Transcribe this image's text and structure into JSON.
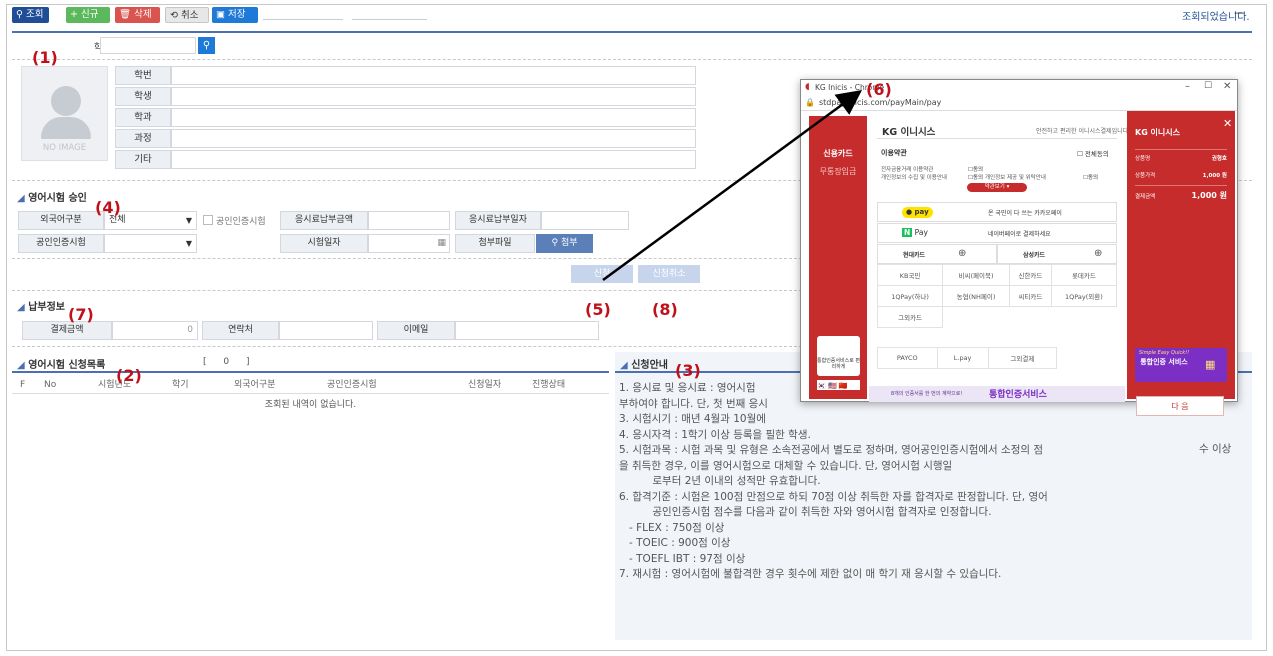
{
  "toolbar": {
    "search_label": "조회",
    "new_label": "신규",
    "delete_label": "삭제",
    "cancel_label": "취소",
    "save_label": "저장",
    "status_text": "조회되었습니다.",
    "minus": "—"
  },
  "search": {
    "student_no_label": "학번"
  },
  "profile": {
    "no_image": "NO IMAGE",
    "fields": [
      "학번",
      "학생",
      "학과",
      "과정",
      "기타"
    ]
  },
  "exam_approval": {
    "title": "영어시험 승인",
    "lang_div_label": "외국어구분",
    "lang_div_value": "전체",
    "cert_exam_check_label": "공인인증시험",
    "fee_amount_label": "응시료납부금액",
    "fee_date_label": "응시료납부일자",
    "cert_exam_label": "공인인증시험",
    "exam_date_label": "시험일자",
    "attach_label": "첨부파일",
    "attach_button": "첨부",
    "apply_button": "신청",
    "apply_cancel_button": "신청취소"
  },
  "payment": {
    "title": "납부정보",
    "amount_label": "결제금액",
    "amount_value": "0",
    "contact_label": "연락처",
    "email_label": "이메일"
  },
  "application_list": {
    "title": "영어시험 신청목록",
    "count": "[ 0 ]",
    "columns": [
      "F",
      "No",
      "시험년도",
      "학기",
      "외국어구분",
      "공인인증시험",
      "신청일자",
      "진행상태"
    ],
    "empty_text": "조회된 내역이 없습니다."
  },
  "guide": {
    "title": "신청안내",
    "lines": [
      "1. 응시료 및 응시료 : 영어시험",
      "부하여야 합니다. 단, 첫 번째 응시",
      "3. 시험시기 : 매년 4월과 10월에",
      "4. 응시자격 : 1학기 이상 등록을 필한 학생.",
      "5. 시험과목 : 시험 과목 및 유형은 소속전공에서 별도로 정하며, 영어공인인증시험에서 소정의 점",
      "을 취득한 경우, 이를 영어시험으로 대체할 수 있습니다. 단, 영어시험 시행일",
      "          로부터 2년 이내의 성적만 유효합니다.",
      "6. 합격기준 : 시험은 100점 만점으로 하되 70점 이상 취득한 자를 합격자로 판정합니다. 단, 영어",
      "          공인인증시험 점수를 다음과 같이 취득한 자와 영어시험 합격자로 인정합니다.",
      "   - FLEX : 750점 이상",
      "   - TOEIC : 900점 이상",
      "   - TOEFL IBT : 97점 이상",
      "7. 재시험 : 영어시험에 불합격한 경우 횟수에 제한 없이 매 학기 재 응시할 수 있습니다."
    ],
    "right_fragment": "수 이상"
  },
  "annotations": [
    "(1)",
    "(2)",
    "(3)",
    "(4)",
    "(5)",
    "(6)",
    "(7)",
    "(8)"
  ],
  "popup": {
    "window_title": "KG Inicis - Chrome",
    "url": "stdpay.inicis.com/payMain/pay",
    "brand": "KG 이니시스",
    "secure_text": "안전하고 편리한 이니시스결제입니다.",
    "left_menu": [
      "신용카드",
      "무통장입금"
    ],
    "terms_title": "이용약관",
    "agree_all": "전체동의",
    "terms_rows": [
      "전자금융거래 이용약관",
      "개인정보의 수집 및 이용안내",
      "개인정보 제공 및 위탁안내"
    ],
    "agree": "동의",
    "more_terms": "약관보기",
    "kakaopay_badge": "pay",
    "kakaopay_text": "온 국민이 다 쓰는 카카오페이",
    "naverpay_badge": "Pay",
    "naverpay_text": "네이버페이로 결제하세요",
    "card_groups": [
      "현대카드",
      "삼성카드"
    ],
    "cards": [
      "KB국민",
      "비씨(페이북)",
      "신한카드",
      "롯데카드",
      "1QPay(하나)",
      "농협(NH페이)",
      "씨티카드",
      "1QPay(외환)",
      "그외카드"
    ],
    "easy_pay": [
      "PAYCO",
      "L.pay",
      "그외결제"
    ],
    "side_brand": "KG 이니시스",
    "product_label": "상품명",
    "product_value": "권형호",
    "price_label": "상품가격",
    "price_value": "1,000 원",
    "total_label": "결제금액",
    "total_value": "1,000 원",
    "promo_small": "Simple Easy Quick!!",
    "promo_big": "통합인증 서비스",
    "bottom_banner": "통합인증서비스",
    "bottom_small": "8개의 인증서를 한 번의 계약으로!",
    "next_button": "다 음",
    "left_promo": "통합인증서비스로 편리하게"
  }
}
